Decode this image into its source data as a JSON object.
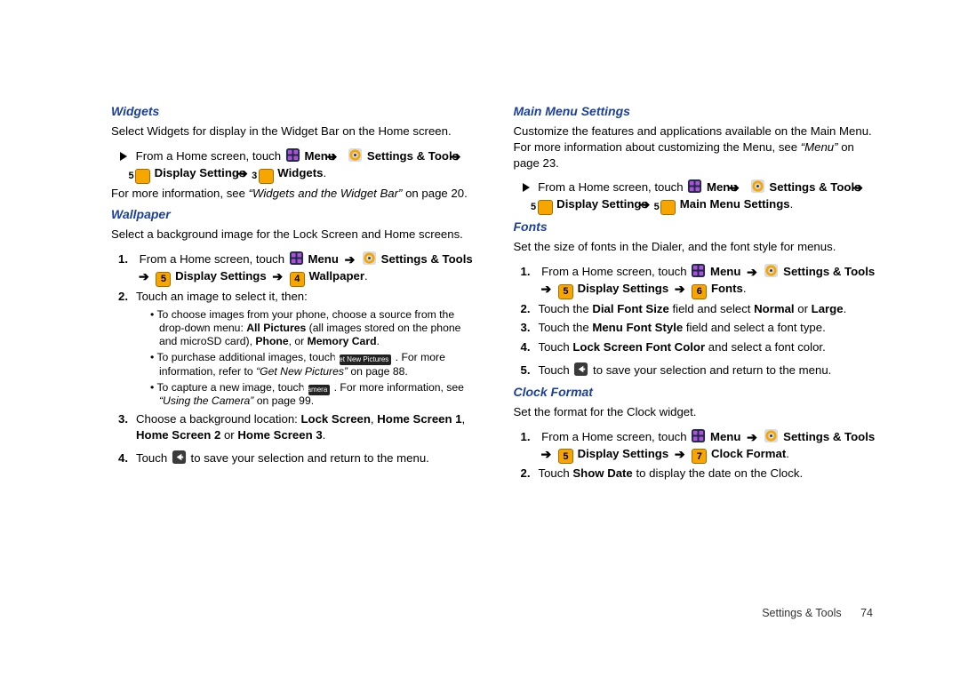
{
  "left": {
    "widgets": {
      "heading": "Widgets",
      "intro": "Select Widgets for display in the Widget Bar on the Home screen.",
      "nav_pre": "From a Home screen, touch",
      "menu": "Menu",
      "settings": "Settings & Tools",
      "disp": "Display Settings",
      "badge1": "5",
      "badge2": "3",
      "widgets_lbl": "Widgets",
      "more_pre": "For more information, see ",
      "more_ref": "“Widgets and the Widget Bar”",
      "more_post": " on page 20."
    },
    "wallpaper": {
      "heading": "Wallpaper",
      "intro": "Select a background image for the Lock Screen and Home screens.",
      "s1_pre": "From a Home screen, touch",
      "menu": "Menu",
      "settings": "Settings & Tools",
      "disp": "Display Settings",
      "badge1": "5",
      "badge2": "4",
      "wallpaper_lbl": "Wallpaper",
      "s2": "Touch an image to select it, then:",
      "b1a": "To choose images from your phone, choose a source from the drop-down menu: ",
      "b1b": "All Pictures",
      "b1c": " (all images stored on the phone and microSD card), ",
      "b1d": "Phone",
      "b1e": ", or ",
      "b1f": "Memory Card",
      "b1g": ".",
      "b2a": "To purchase additional images, touch ",
      "b2pill": "Get New Pictures",
      "b2b": " . For more information, refer to ",
      "b2ref": "“Get New Pictures”",
      "b2c": "  on page 88.",
      "b3a": "To capture a new image, touch ",
      "b3pill": "Camera",
      "b3b": " . For more information, see ",
      "b3ref": "“Using the Camera”",
      "b3c": " on page 99.",
      "s3a": "Choose a background location: ",
      "s3b": "Lock Screen",
      "s3c": ", ",
      "s3d": "Home Screen 1",
      "s3e": ", ",
      "s3f": "Home Screen 2",
      "s3g": " or ",
      "s3h": "Home Screen 3",
      "s3i": ".",
      "s4a": "Touch ",
      "s4b": " to save your selection and return to the menu."
    }
  },
  "right": {
    "mainmenu": {
      "heading": "Main Menu Settings",
      "intro": "Customize the features and applications available on the Main Menu.  For more information about customizing the Menu, see ",
      "ref": "“Menu”",
      "refpost": " on page 23.",
      "nav_pre": "From a Home screen, touch",
      "menu": "Menu",
      "settings": "Settings & Tools",
      "disp": "Display Settings",
      "badge1": "5",
      "badge2": "5",
      "label": "Main Menu Settings"
    },
    "fonts": {
      "heading": "Fonts",
      "intro": "Set the size of fonts in the Dialer, and the font style for menus.",
      "s1_pre": "From a Home screen, touch",
      "menu": "Menu",
      "settings": "Settings & Tools",
      "disp": "Display Settings",
      "badge1": "5",
      "badge2": "6",
      "label": "Fonts",
      "s2a": "Touch the ",
      "s2b": "Dial Font Size",
      "s2c": " field and select ",
      "s2d": "Normal",
      "s2e": " or ",
      "s2f": "Large",
      "s2g": ".",
      "s3a": "Touch the ",
      "s3b": "Menu Font Style",
      "s3c": " field and select a font type.",
      "s4a": "Touch ",
      "s4b": "Lock Screen Font Color",
      "s4c": " and select a font color.",
      "s5a": "Touch ",
      "s5b": " to save your selection and return to the menu."
    },
    "clock": {
      "heading": "Clock Format",
      "intro": "Set the format for the Clock widget.",
      "s1_pre": "From a Home screen, touch",
      "menu": "Menu",
      "settings": "Settings & Tools",
      "disp": "Display Settings",
      "badge1": "5",
      "badge2": "7",
      "label": "Clock Format",
      "s2a": "Touch ",
      "s2b": "Show Date",
      "s2c": " to display the date on the Clock."
    }
  },
  "footer": {
    "section": "Settings & Tools",
    "page": "74"
  }
}
